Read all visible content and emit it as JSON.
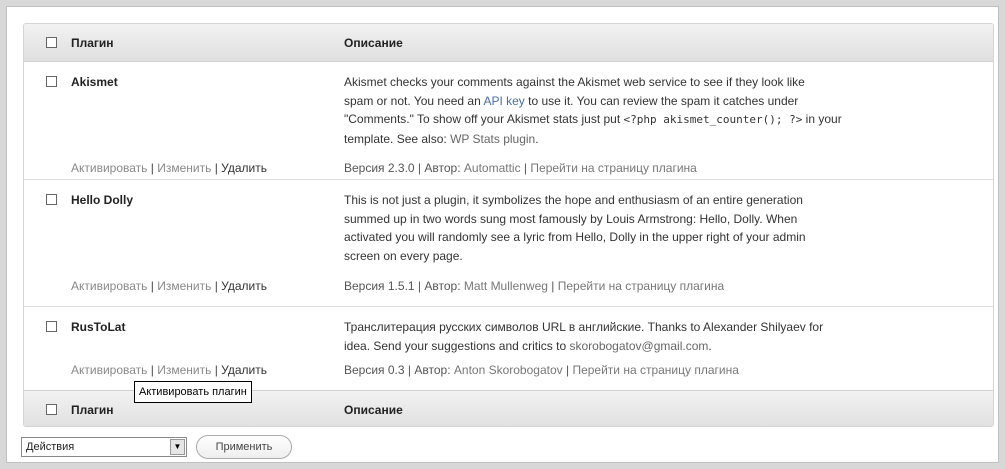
{
  "table": {
    "header": {
      "plugin_label": "Плагин",
      "description_label": "Описание"
    },
    "footer": {
      "plugin_label": "Плагин",
      "description_label": "Описание"
    },
    "plugins": [
      {
        "name": "Akismet",
        "description": {
          "line1": "Akismet checks your comments against the Akismet web service to see if they look like",
          "line2a": "spam or not. You need an ",
          "api_key_link": "API key",
          "line2b": " to use it. You can review the spam it catches under",
          "line3": "\"Comments.\" To show off your Akismet stats just put ",
          "code": "<?php akismet_counter(); ?>",
          "line3b": " in your",
          "line4a": "template. See also: ",
          "wp_stats_link": "WP Stats plugin",
          "line4b": "."
        },
        "actions": {
          "activate": "Активировать",
          "edit": "Изменить",
          "delete": "Удалить"
        },
        "meta": {
          "version": "Версия 2.3.0",
          "author_label": "Автор:",
          "author": "Automattic",
          "site_link": "Перейти на страницу плагина"
        }
      },
      {
        "name": "Hello Dolly",
        "description": {
          "line1": "This is not just a plugin, it symbolizes the hope and enthusiasm of an entire generation",
          "line2": "summed up in two words sung most famously by Louis Armstrong: Hello, Dolly. When",
          "line3": "activated you will randomly see a lyric from Hello, Dolly in the upper right of your admin",
          "line4": "screen on every page."
        },
        "actions": {
          "activate": "Активировать",
          "edit": "Изменить",
          "delete": "Удалить"
        },
        "meta": {
          "version": "Версия 1.5.1",
          "author_label": "Автор:",
          "author": "Matt Mullenweg",
          "site_link": "Перейти на страницу плагина"
        }
      },
      {
        "name": "RusToLat",
        "description": {
          "line1": "Транслитерация русских символов URL в английские. Thanks to Alexander Shilyaev for",
          "line2a": "idea. Send your suggestions and critics to ",
          "email": "skorobogatov@gmail.com",
          "line2b": "."
        },
        "actions": {
          "activate": "Активировать",
          "edit": "Изменить",
          "delete": "Удалить"
        },
        "meta": {
          "version": "Версия 0.3",
          "author_label": "Автор:",
          "author": "Anton Skorobogatov",
          "site_link": "Перейти на страницу плагина"
        }
      }
    ]
  },
  "tooltip": "Активировать плагин",
  "bulk": {
    "select_value": "Действия",
    "apply_label": "Применить"
  },
  "colors": {
    "header_bg": "#e4e4e4",
    "link": "#666666",
    "frame_bg": "#d8d8d8"
  }
}
